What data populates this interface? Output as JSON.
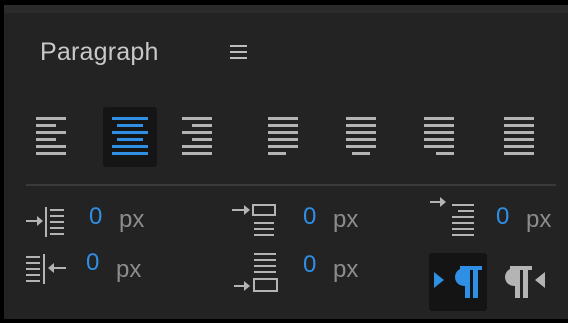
{
  "panel": {
    "title": "Paragraph",
    "menu_icon": "hamburger-menu-icon"
  },
  "alignment": {
    "buttons": [
      {
        "name": "align-left-icon",
        "selected": false
      },
      {
        "name": "align-center-icon",
        "selected": true
      },
      {
        "name": "align-right-icon",
        "selected": false
      },
      {
        "name": "justify-last-left-icon",
        "selected": false
      },
      {
        "name": "justify-last-center-icon",
        "selected": false
      },
      {
        "name": "justify-last-right-icon",
        "selected": false
      },
      {
        "name": "justify-all-icon",
        "selected": false
      }
    ],
    "selected_color": "#2f8fe4",
    "icon_color": "#b4b4b4"
  },
  "spacing": {
    "indent_left": {
      "value": "0",
      "unit": "px"
    },
    "first_line_indent": {
      "value": "0",
      "unit": "px"
    },
    "space_before": {
      "value": "0",
      "unit": "px"
    },
    "indent_right": {
      "value": "0",
      "unit": "px"
    },
    "space_after": {
      "value": "0",
      "unit": "px"
    },
    "value_color": "#2f8fe4"
  },
  "direction": {
    "ltr": {
      "icon": "ltr-paragraph-icon",
      "selected": true
    },
    "rtl": {
      "icon": "rtl-paragraph-icon",
      "selected": false
    }
  }
}
